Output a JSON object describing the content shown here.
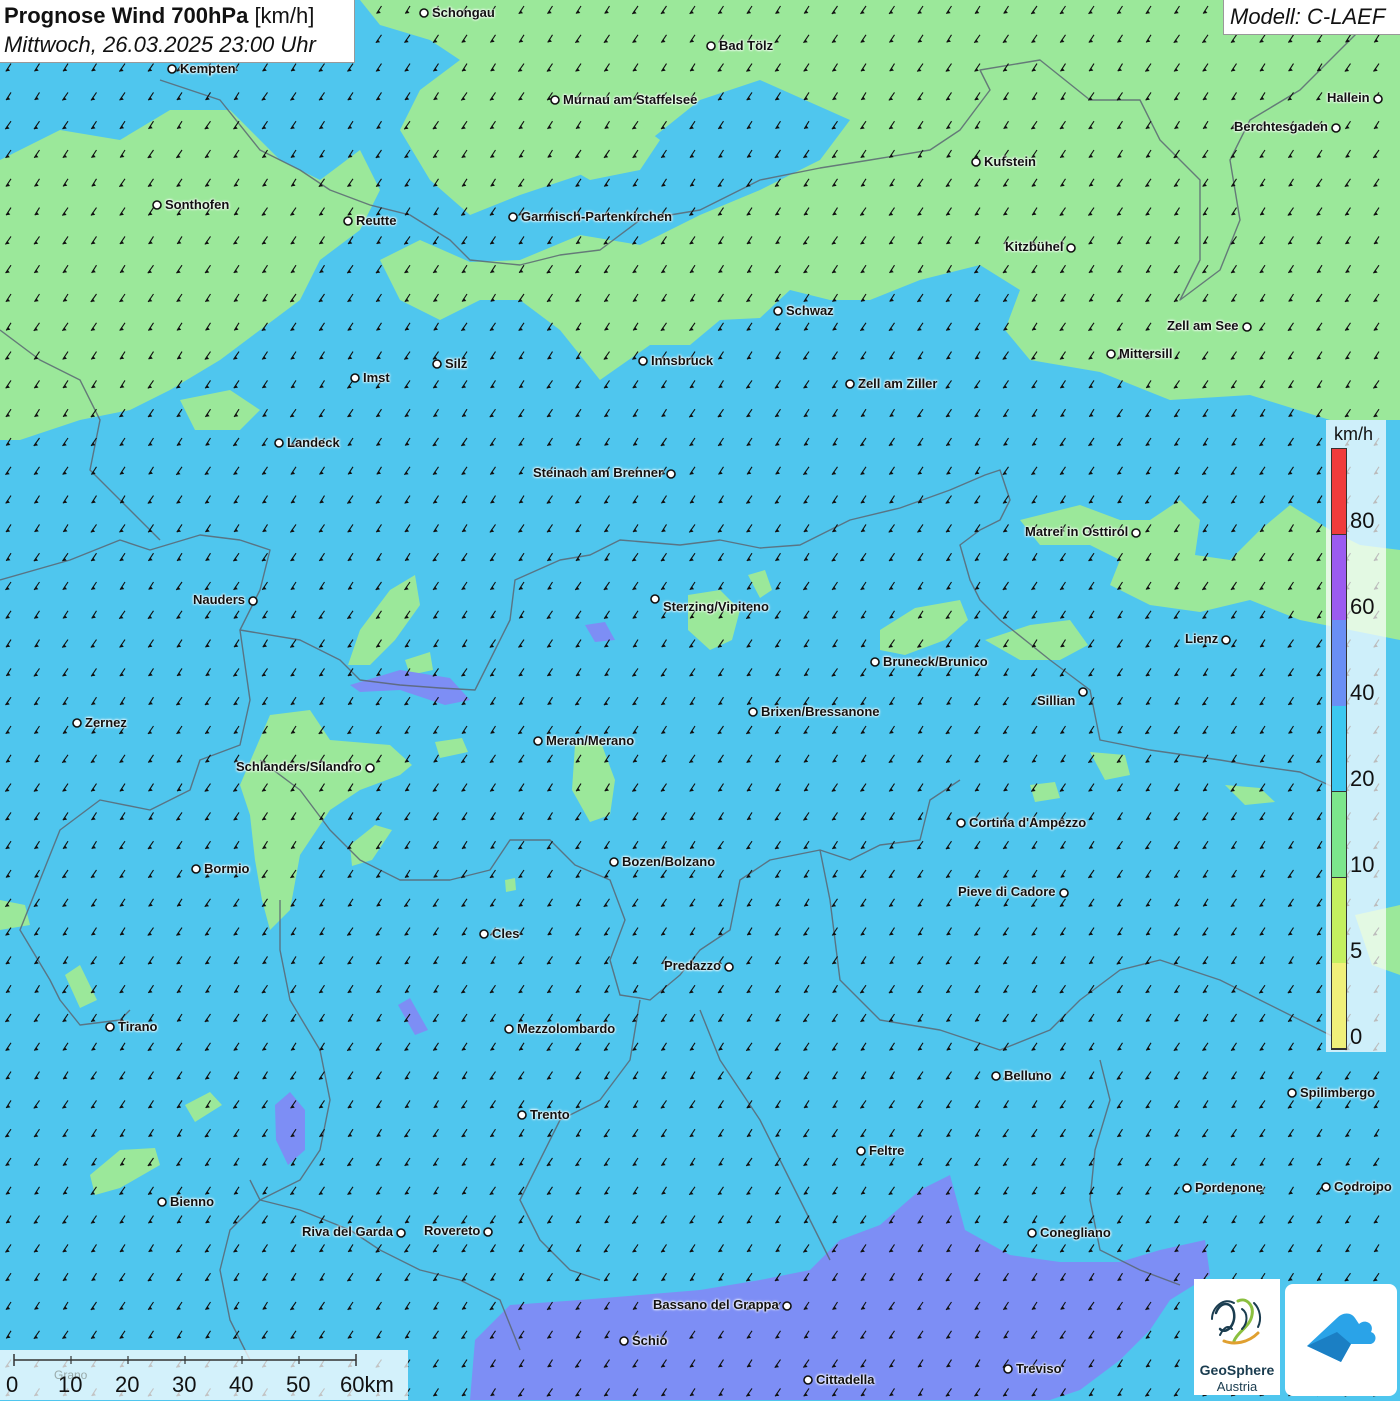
{
  "title": {
    "main": "Prognose Wind 700hPa",
    "unit": "[km/h]",
    "datetime": "Mittwoch, 26.03.2025 23:00 Uhr"
  },
  "model": "Modell: C-LAEF",
  "legend": {
    "unit": "km/h",
    "ticks": [
      "80",
      "60",
      "40",
      "20",
      "10",
      "5",
      "0"
    ],
    "colors": [
      "#f03c3c",
      "#9b5cf0",
      "#6a8ff5",
      "#3cc8f0",
      "#7ce68c",
      "#c4f060",
      "#f0f07a"
    ]
  },
  "scale": {
    "labels": [
      "0",
      "10",
      "20",
      "30",
      "40",
      "50",
      "60km"
    ],
    "faint_label": "Grano"
  },
  "colors": {
    "map_blue": "#4fc6ee",
    "map_green": "#9be89a",
    "map_purple": "#7d8ef5",
    "borders": "#5a6672"
  },
  "cities": [
    {
      "name": "Schongau"
    },
    {
      "name": "Bad Tölz"
    },
    {
      "name": "Kempten"
    },
    {
      "name": "Murnau am Staffelsee"
    },
    {
      "name": "Hallein"
    },
    {
      "name": "Berchtesgaden"
    },
    {
      "name": "Kufstein"
    },
    {
      "name": "Sonthofen"
    },
    {
      "name": "Reutte"
    },
    {
      "name": "Garmisch-Partenkirchen"
    },
    {
      "name": "Kitzbühel"
    },
    {
      "name": "Schwaz"
    },
    {
      "name": "Zell am See"
    },
    {
      "name": "Mittersill"
    },
    {
      "name": "Innsbruck"
    },
    {
      "name": "Silz"
    },
    {
      "name": "Imst"
    },
    {
      "name": "Zell am Ziller"
    },
    {
      "name": "Landeck"
    },
    {
      "name": "Steinach am Brenner"
    },
    {
      "name": "Matrei in Osttirol"
    },
    {
      "name": "Nauders"
    },
    {
      "name": "Sterzing/Vipiteno"
    },
    {
      "name": "Lienz"
    },
    {
      "name": "Bruneck/Brunico"
    },
    {
      "name": "Sillian"
    },
    {
      "name": "Zernez"
    },
    {
      "name": "Brixen/Bressanone"
    },
    {
      "name": "Meran/Merano"
    },
    {
      "name": "Schlanders/Silandro"
    },
    {
      "name": "Cortina d'Ampezzo"
    },
    {
      "name": "Bozen/Bolzano"
    },
    {
      "name": "Bormio"
    },
    {
      "name": "Pieve di Cadore"
    },
    {
      "name": "Cles"
    },
    {
      "name": "Predazzo"
    },
    {
      "name": "Tirano"
    },
    {
      "name": "Mezzolombardo"
    },
    {
      "name": "Belluno"
    },
    {
      "name": "Spilimbergo"
    },
    {
      "name": "Trento"
    },
    {
      "name": "Feltre"
    },
    {
      "name": "Pordenone"
    },
    {
      "name": "Codroipo"
    },
    {
      "name": "Bienno"
    },
    {
      "name": "Riva del Garda"
    },
    {
      "name": "Rovereto"
    },
    {
      "name": "Conegliano"
    },
    {
      "name": "Bassano del Grappa"
    },
    {
      "name": "Schio"
    },
    {
      "name": "Treviso"
    },
    {
      "name": "Cittadella"
    }
  ],
  "logos": {
    "geosphere_name": "GeoSphere",
    "geosphere_sub": "Austria"
  },
  "icons": [
    "wind-arrow-icon",
    "geosphere-logo-icon",
    "app-logo-icon",
    "city-marker-icon"
  ]
}
